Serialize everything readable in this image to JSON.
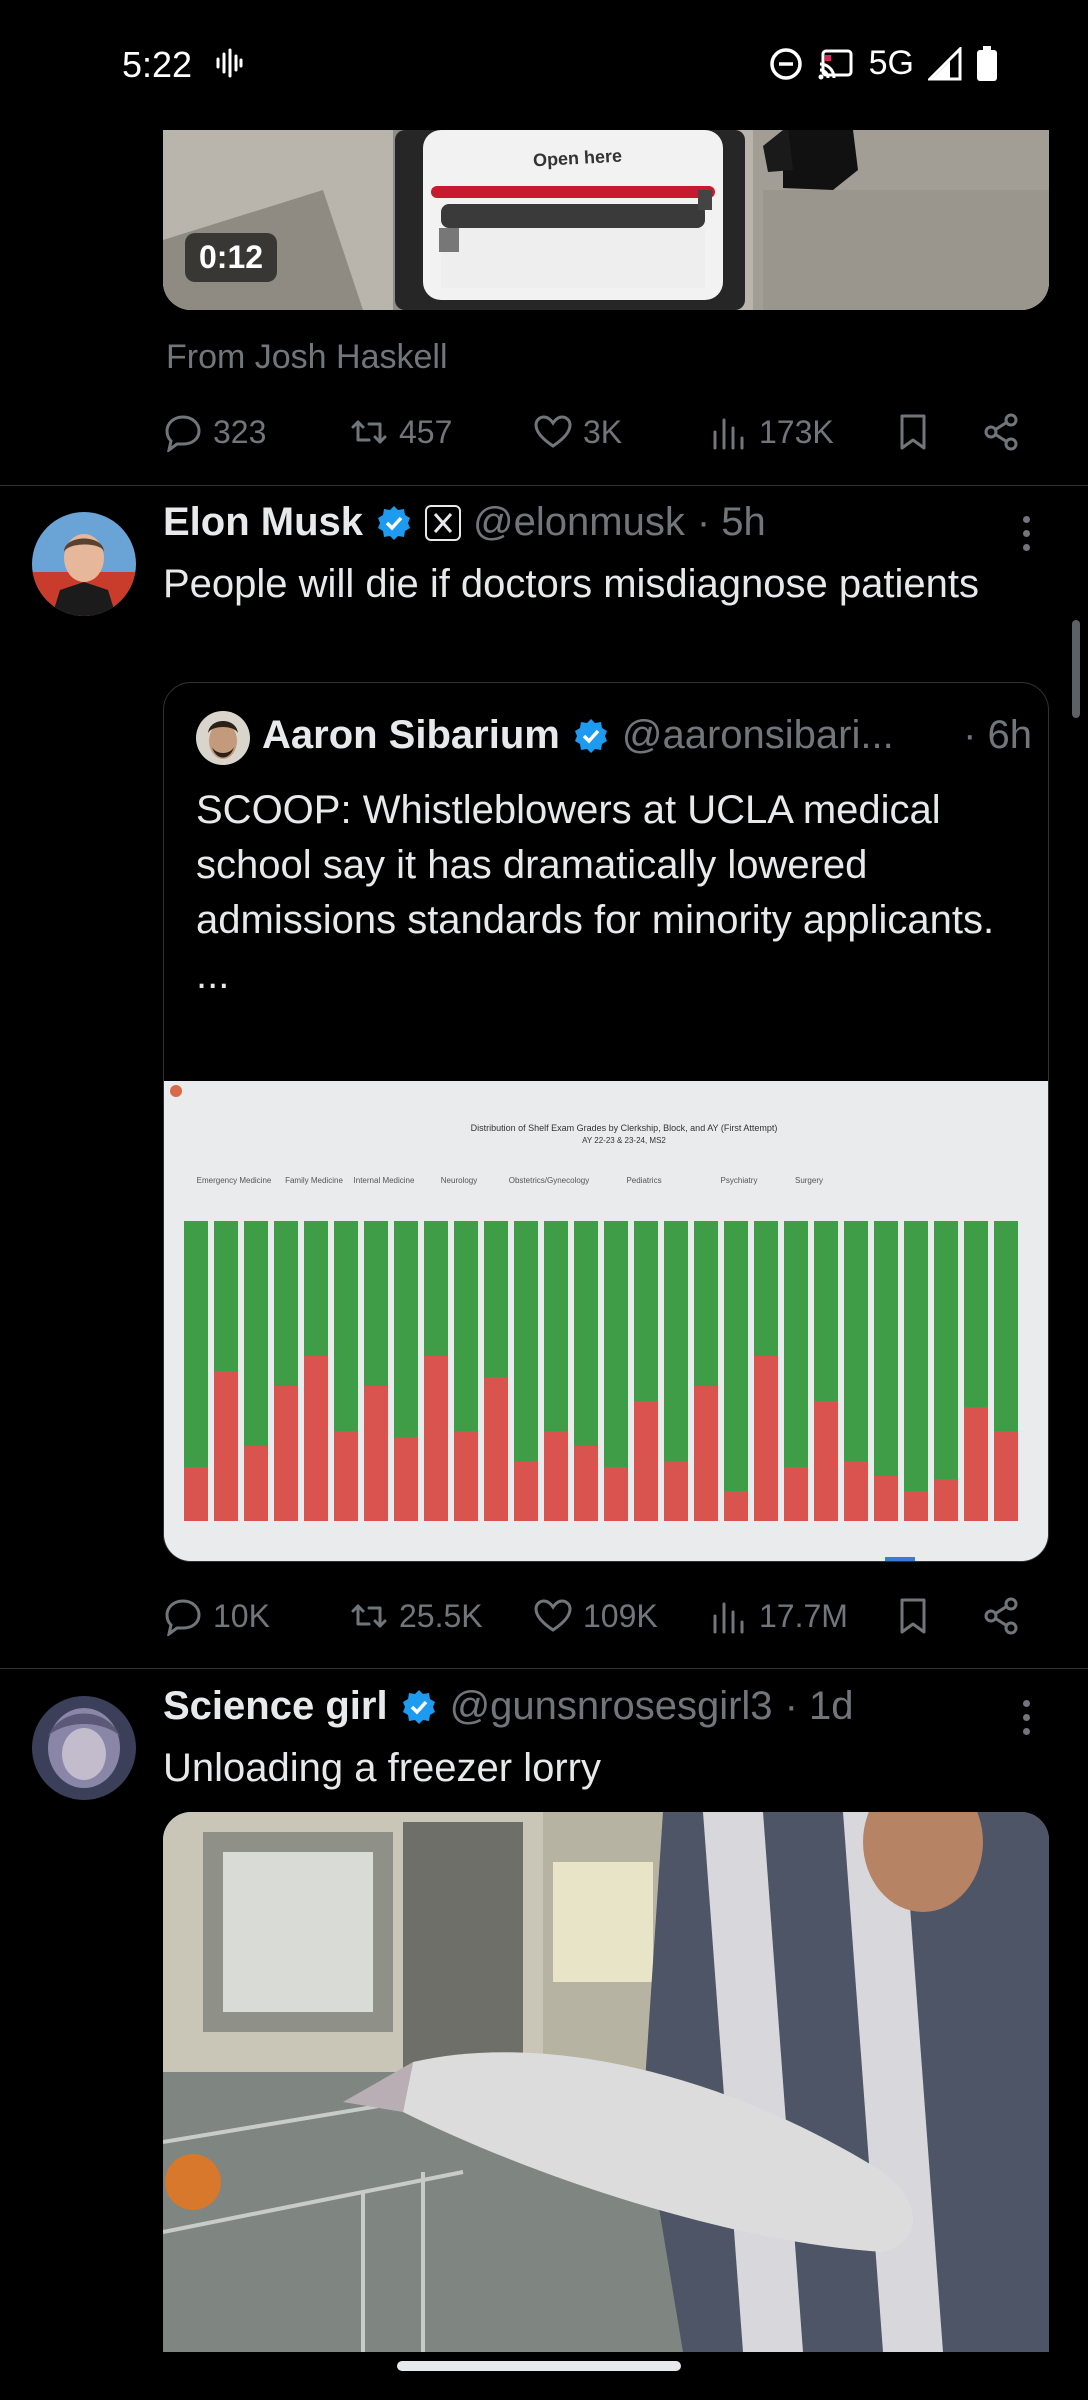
{
  "status_bar": {
    "time": "5:22",
    "network": "5G",
    "icons": [
      "voice-wave-icon",
      "do-not-disturb-icon",
      "cast-icon",
      "signal-icon",
      "battery-icon"
    ]
  },
  "tweet1": {
    "duration": "0:12",
    "media_sign": "Open here",
    "from_line": "From Josh Haskell",
    "stats": {
      "replies": "323",
      "reposts": "457",
      "likes": "3K",
      "views": "173K"
    }
  },
  "tweet2": {
    "author": "Elon Musk",
    "handle": "@elonmusk",
    "time": "· 5h",
    "text": "People will die if doctors misdiagnose patients",
    "quote": {
      "author": "Aaron Sibarium",
      "handle": "@aaronsibari...",
      "time": "· 6h",
      "text": "SCOOP: Whistleblowers at UCLA medical school say it has dramatically lowered admissions standards for minority applicants.",
      "ellipsis": "...",
      "image_title": "Distribution of Shelf Exam Grades by Clerkship, Block, and AY (First Attempt)",
      "image_subtitle": "AY 22-23 & 23-24, MS2",
      "clerkships": [
        "Emergency Medicine",
        "Family Medicine",
        "Internal Medicine",
        "Neurology",
        "Obstetrics/Gynecology",
        "Pediatrics",
        "Psychiatry",
        "Surgery"
      ]
    },
    "stats": {
      "replies": "10K",
      "reposts": "25.5K",
      "likes": "109K",
      "views": "17.7M"
    }
  },
  "tweet3": {
    "author": "Science girl",
    "handle": "@gunsnrosesgirl3",
    "time": "· 1d",
    "text": "Unloading a freezer lorry"
  },
  "colors": {
    "background": "#000000",
    "text": "#e7e9ea",
    "muted": "#71767b",
    "verified": "#1d9bf0",
    "divider": "#2f3336"
  }
}
